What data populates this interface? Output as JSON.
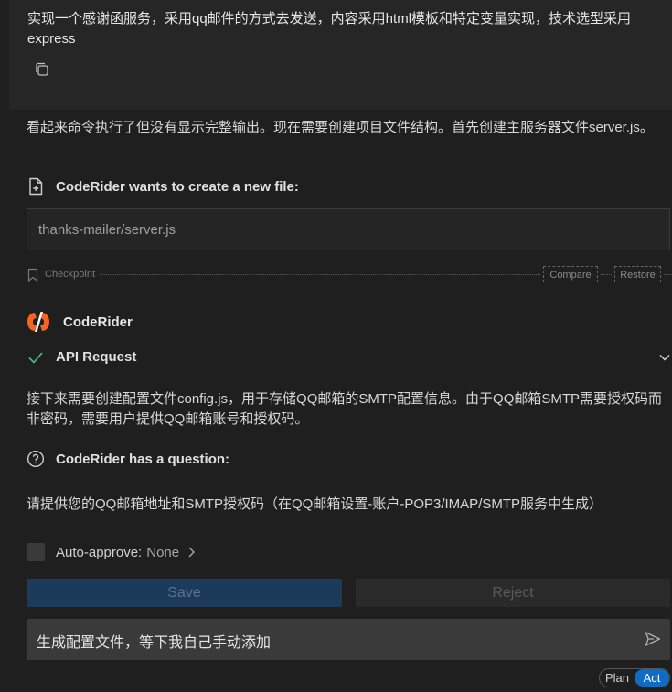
{
  "user_message": {
    "text": "实现一个感谢函服务，采用qq邮件的方式去发送，内容采用html模板和特定变量实现，技术选型采用express"
  },
  "assistant": {
    "intro_text": "看起来命令执行了但没有显示完整输出。现在需要创建项目文件结构。首先创建主服务器文件server.js。",
    "create_file_heading": "CodeRider wants to create a new file:",
    "file_path": "thanks-mailer/server.js"
  },
  "checkpoint": {
    "label": "Checkpoint",
    "compare_label": "Compare",
    "restore_label": "Restore"
  },
  "brand": {
    "name": "CodeRider",
    "colors": {
      "accent": "#f26522"
    }
  },
  "api_request": {
    "label": "API Request",
    "status_icon": "check-icon"
  },
  "explanation": "接下来需要创建配置文件config.js，用于存储QQ邮箱的SMTP配置信息。由于QQ邮箱SMTP需要授权码而非密码，需要用户提供QQ邮箱账号和授权码。",
  "question": {
    "heading": "CodeRider has a question:",
    "text": "请提供您的QQ邮箱地址和SMTP授权码（在QQ邮箱设置-账户-POP3/IMAP/SMTP服务中生成）"
  },
  "auto_approve": {
    "label": "Auto-approve:",
    "value": "None",
    "checked": false
  },
  "actions": {
    "save_label": "Save",
    "reject_label": "Reject"
  },
  "chat_input": {
    "value": "生成配置文件，等下我自己手动添加"
  },
  "mode": {
    "plan_label": "Plan",
    "act_label": "Act",
    "active": "Act"
  }
}
